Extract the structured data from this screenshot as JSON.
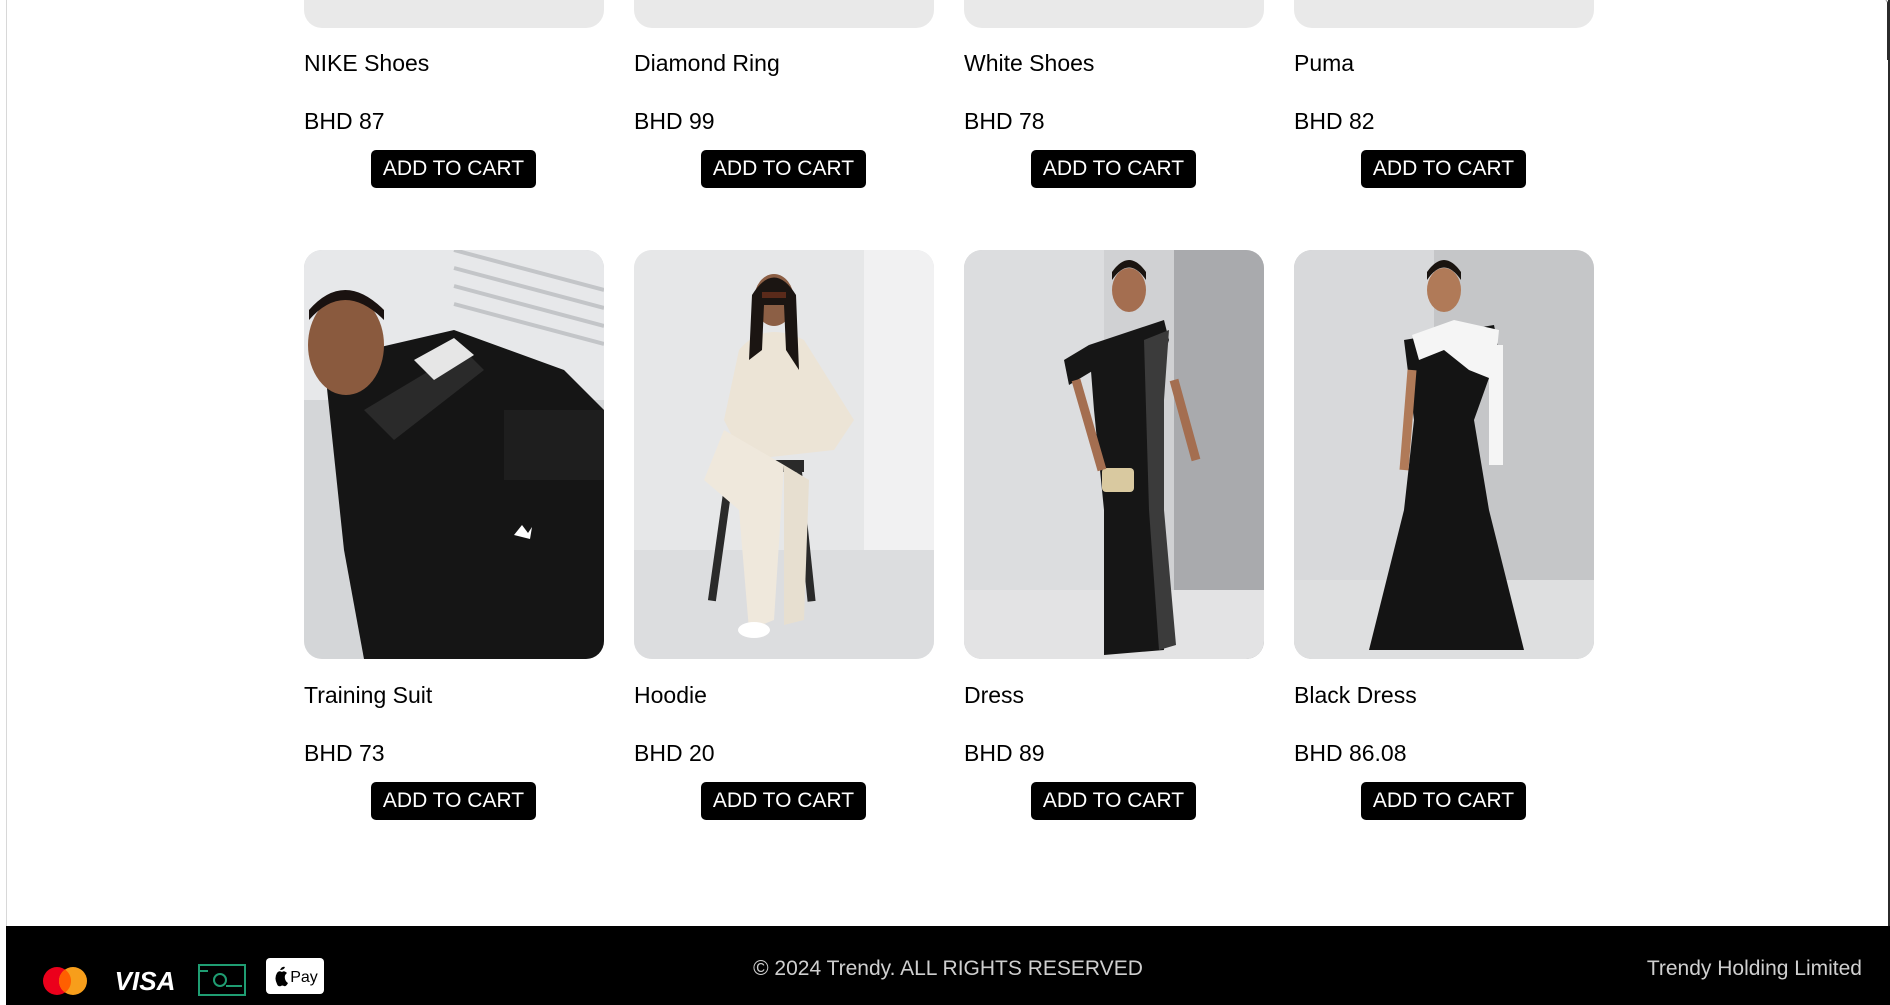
{
  "products_row1": [
    {
      "title": "NIKE Shoes",
      "price": "BHD 87",
      "button": "ADD TO CART"
    },
    {
      "title": "Diamond Ring",
      "price": "BHD 99",
      "button": "ADD TO CART"
    },
    {
      "title": "White Shoes",
      "price": "BHD 78",
      "button": "ADD TO CART"
    },
    {
      "title": "Puma",
      "price": "BHD 82",
      "button": "ADD TO CART"
    }
  ],
  "products_row2": [
    {
      "title": "Training Suit",
      "price": "BHD 73",
      "button": "ADD TO CART"
    },
    {
      "title": "Hoodie",
      "price": "BHD 20",
      "button": "ADD TO CART"
    },
    {
      "title": "Dress",
      "price": "BHD 89",
      "button": "ADD TO CART"
    },
    {
      "title": "Black Dress",
      "price": "BHD 86.08",
      "button": "ADD TO CART"
    }
  ],
  "footer": {
    "payment_icons": [
      "mastercard-icon",
      "visa-icon",
      "cash-icon",
      "apple-pay-icon"
    ],
    "visa_text": "VISA",
    "apple_pay_text": "Pay",
    "copyright": "© 2024 Trendy. ALL RIGHTS RESERVED",
    "company": "Trendy Holding Limited"
  },
  "colors": {
    "button_bg": "#000000",
    "button_text": "#ffffff",
    "footer_bg": "#000000",
    "footer_text": "#cfcfcf",
    "placeholder_bg": "#e9e9e9",
    "cash_icon": "#1f9d72",
    "mastercard_red": "#eb001b",
    "mastercard_orange": "#f79e1b"
  }
}
